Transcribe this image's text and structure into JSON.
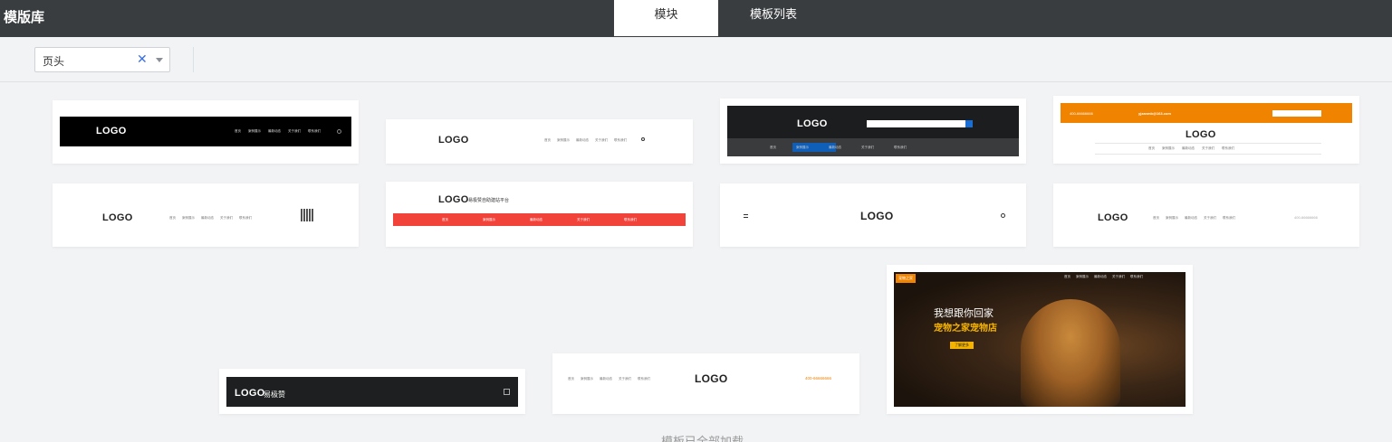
{
  "app": {
    "title": "模版库"
  },
  "tabs": [
    {
      "label": "模块"
    },
    {
      "label": "模板列表"
    }
  ],
  "filter": {
    "category_value": "页头"
  },
  "cards": {
    "c1": {
      "logo": "LOGO"
    },
    "c2": {
      "logo": "LOGO"
    },
    "c3": {
      "logo": "LOGO"
    },
    "c4": {
      "logo": "LOGO",
      "email": "yjzanmb@163.com",
      "phone": "400-66666666"
    },
    "c5": {
      "logo": "LOGO"
    },
    "c6": {
      "logo": "LOGO",
      "tagline": "易极赞自助建站平台"
    },
    "c7": {
      "logo": "LOGO"
    },
    "c8": {
      "logo": "LOGO",
      "phone": "400-66666666"
    },
    "c9": {
      "badge": "宠物之家",
      "headline": "我想跟你回家",
      "subline": "宠物之家宠物店",
      "cta": "了解更多"
    },
    "c10": {
      "logo": "LOGO",
      "brand": "易极赞"
    },
    "c11": {
      "logo": "LOGO",
      "phone": "400-66666666"
    }
  },
  "nav_items": [
    "首页",
    "案例展示",
    "最新动态",
    "关于我们",
    "联系我们"
  ],
  "status": {
    "all_loaded": "模板已全部加载"
  },
  "colors": {
    "topbar": "#393d40",
    "accent_blue": "#3a6fe0",
    "orange": "#f08300",
    "red": "#f2433b",
    "dark": "#1e1f20"
  }
}
